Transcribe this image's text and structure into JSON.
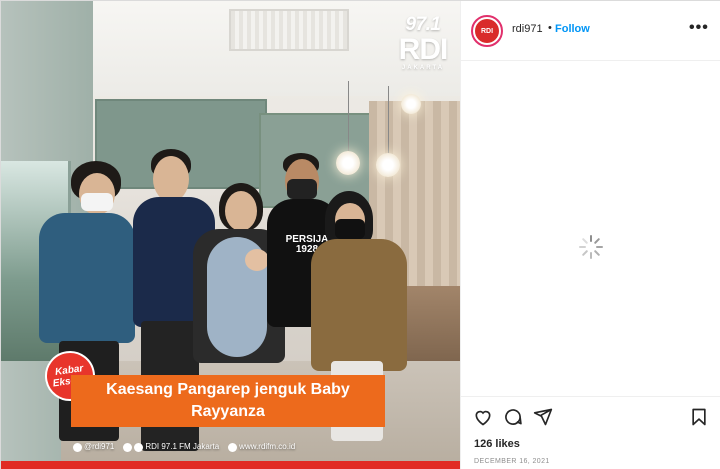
{
  "post": {
    "brand_frequency": "97.1",
    "brand_name": "RDI",
    "brand_city": "JAKARTA",
    "badge_line1": "Kabar",
    "badge_line2": "Ekseizz",
    "headline_line1": "Kaesang Pangarep jenguk Baby",
    "headline_line2": "Rayyanza",
    "footer_instagram": "@rdi971",
    "footer_station": "RDI 97.1 FM Jakarta",
    "footer_website": "www.rdifm.co.id",
    "shirt_text": "PERSIJA 1928"
  },
  "sidebar": {
    "avatar_text": "RDI",
    "username": "rdi971",
    "dot": "•",
    "follow_label": "Follow",
    "more_label": "•••",
    "likes": "126 likes",
    "date": "DECEMBER 16, 2021"
  },
  "icons": {
    "like": "heart-icon",
    "comment": "comment-icon",
    "share": "paper-plane-icon",
    "save": "bookmark-icon",
    "loading": "loading-spinner-icon"
  },
  "colors": {
    "follow": "#0095f6",
    "headline_bg": "#ed6a1c",
    "badge_bg": "#e8352b",
    "footer_line": "#e12b23"
  }
}
